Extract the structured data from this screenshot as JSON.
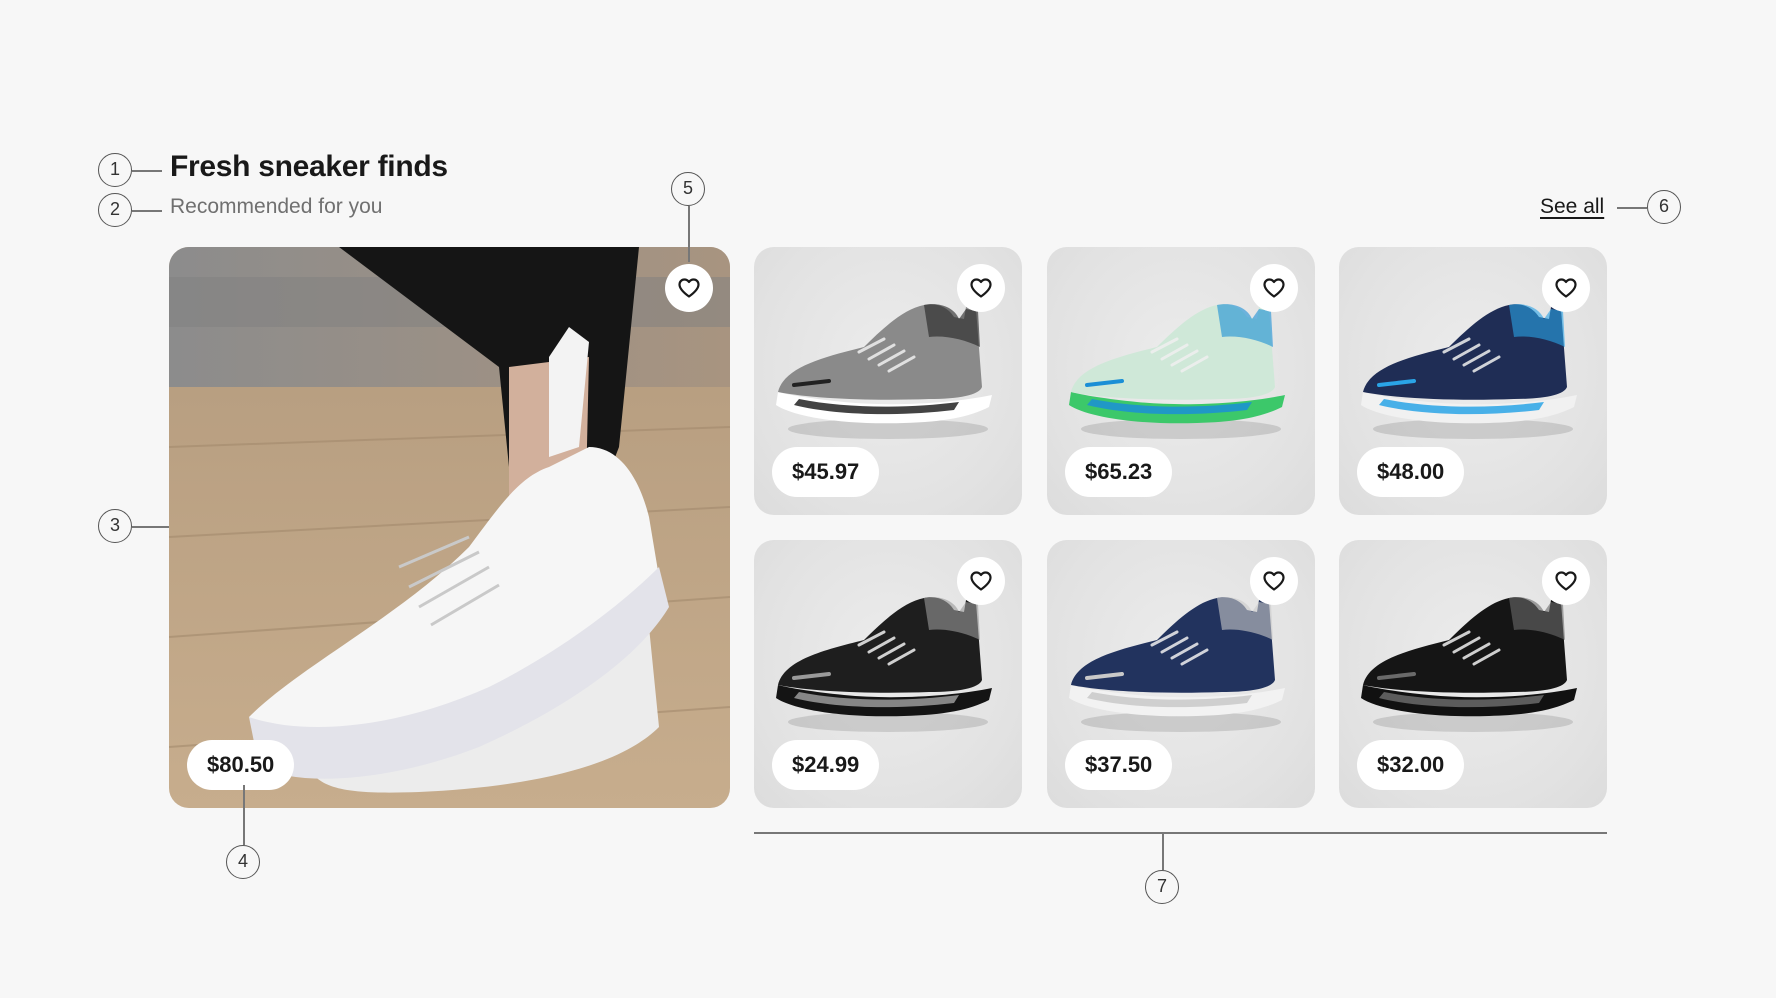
{
  "header": {
    "title": "Fresh sneaker finds",
    "subtitle": "Recommended for you",
    "see_all_label": "See all"
  },
  "hero": {
    "price": "$80.50",
    "favorite_icon": "heart-outline-icon"
  },
  "products": [
    {
      "price": "$45.97",
      "colors": {
        "upper": "#8a8a8a",
        "sole": "#ffffff",
        "accent": "#222222"
      }
    },
    {
      "price": "$65.23",
      "colors": {
        "upper": "#cfe8d8",
        "sole": "#3cc86a",
        "accent": "#1b8fd6"
      }
    },
    {
      "price": "$48.00",
      "colors": {
        "upper": "#1f2d55",
        "sole": "#f1f1f1",
        "accent": "#2aa4e6"
      }
    },
    {
      "price": "$24.99",
      "colors": {
        "upper": "#1e1e1e",
        "sole": "#141414",
        "accent": "#9a9a9a"
      }
    },
    {
      "price": "$37.50",
      "colors": {
        "upper": "#22335e",
        "sole": "#f2f2f2",
        "accent": "#c9c9c9"
      }
    },
    {
      "price": "$32.00",
      "colors": {
        "upper": "#151515",
        "sole": "#111111",
        "accent": "#6a6a6a"
      }
    }
  ],
  "callouts": [
    "1",
    "2",
    "3",
    "4",
    "5",
    "6",
    "7"
  ]
}
